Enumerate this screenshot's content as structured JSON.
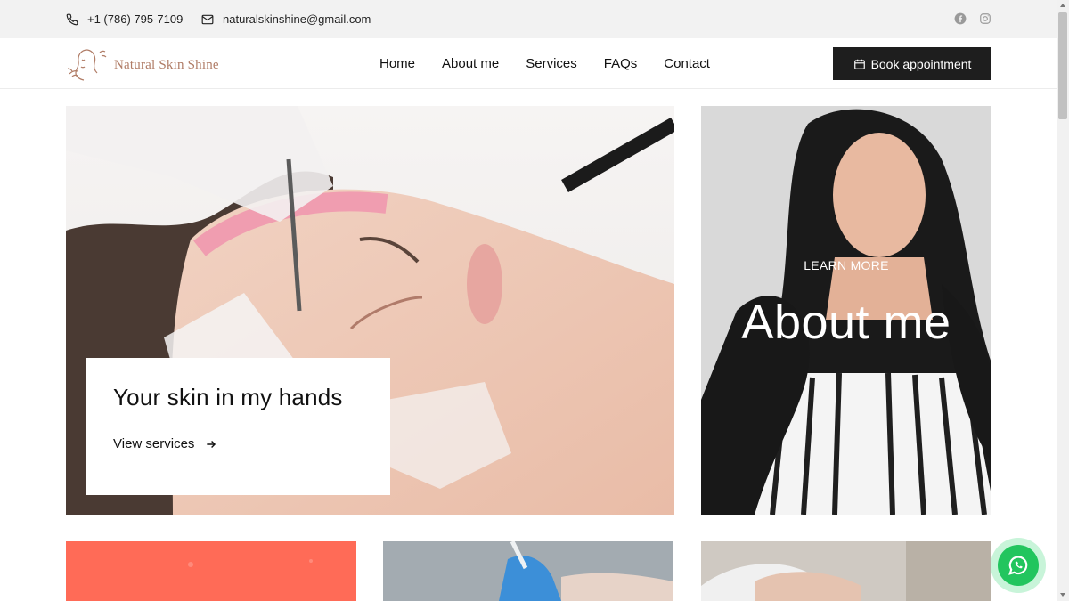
{
  "topbar": {
    "phone": "+1 (786) 795-7109",
    "email": "naturalskinshine@gmail.com",
    "social_icons": [
      "facebook-icon",
      "instagram-icon"
    ]
  },
  "header": {
    "logo_text": "Natural Skin Shine",
    "nav": [
      "Home",
      "About me",
      "Services",
      "FAQs",
      "Contact"
    ],
    "book_label": "Book appointment"
  },
  "hero": {
    "title": "Your skin in my hands",
    "link_label": "View services"
  },
  "about": {
    "subtitle": "LEARN MORE",
    "title": "About me"
  },
  "colors": {
    "accent_logo": "#b07c66",
    "dark_button": "#1e1e1e",
    "card_coral": "#ff6b57",
    "whatsapp": "#22c55e"
  }
}
